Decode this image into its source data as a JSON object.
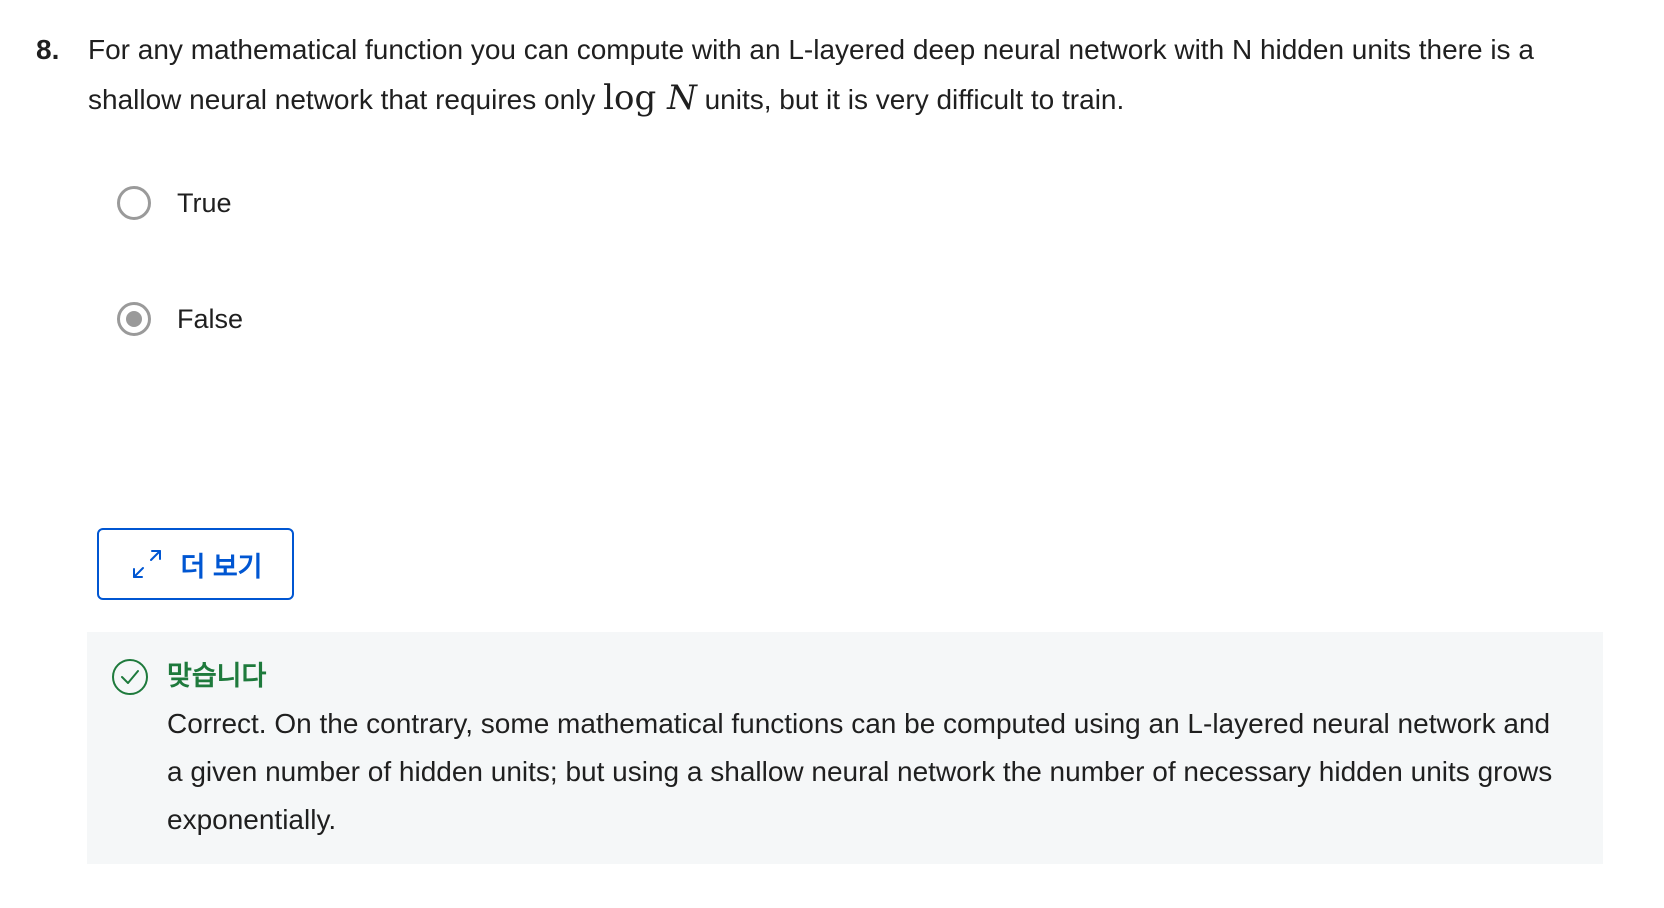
{
  "question": {
    "number": "8.",
    "text_before": "For any mathematical function you can compute with an L-layered deep neural network with N hidden units there is a shallow neural network that requires only ",
    "math_func": "log",
    "math_var": "N",
    "text_after": " units, but it is very difficult to train."
  },
  "options": [
    {
      "label": "True",
      "selected": false
    },
    {
      "label": "False",
      "selected": true
    }
  ],
  "more_button": {
    "label": "더 보기",
    "icon": "expand-arrows-icon",
    "color": "#0056d2"
  },
  "feedback": {
    "title": "맞습니다",
    "icon": "check-circle-icon",
    "title_color": "#1e7a3c",
    "text": "Correct. On the contrary, some mathematical functions can be computed using an L-layered neural network and a given number of hidden units; but using a shallow neural network the number of necessary hidden units grows exponentially."
  }
}
